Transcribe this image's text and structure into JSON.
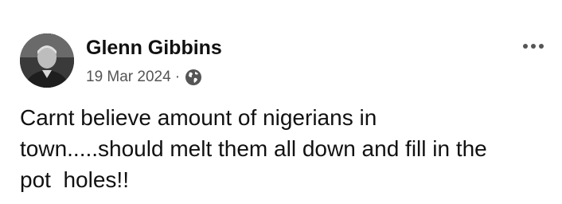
{
  "post": {
    "author": {
      "name": "Glenn Gibbins",
      "avatar_icon": "profile-photo"
    },
    "meta": {
      "date": "19 Mar 2024",
      "separator": "·",
      "audience_icon": "globe-icon"
    },
    "more_options_icon": "more-horizontal-icon",
    "text": "Carnt believe amount of nigerians in\ntown.....should melt them all down and fill in the\npot  holes!!"
  }
}
